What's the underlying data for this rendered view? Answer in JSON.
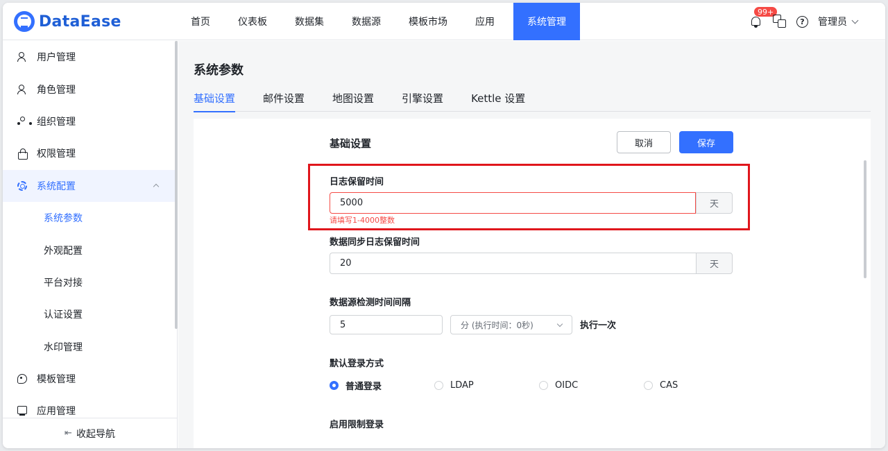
{
  "app": {
    "name": "DataEase"
  },
  "topnav": {
    "items": [
      {
        "label": "首页"
      },
      {
        "label": "仪表板"
      },
      {
        "label": "数据集"
      },
      {
        "label": "数据源"
      },
      {
        "label": "模板市场"
      },
      {
        "label": "应用"
      },
      {
        "label": "系统管理"
      }
    ],
    "active_index": 6
  },
  "header": {
    "notification_badge": "99+",
    "user": "管理员",
    "help_icon": "?"
  },
  "sidebar": {
    "items": [
      {
        "label": "用户管理",
        "icon": "user-icon"
      },
      {
        "label": "角色管理",
        "icon": "role-icon"
      },
      {
        "label": "组织管理",
        "icon": "org-icon"
      },
      {
        "label": "权限管理",
        "icon": "lock-icon"
      },
      {
        "label": "系统配置",
        "icon": "gear-icon"
      },
      {
        "label": "系统参数"
      },
      {
        "label": "外观配置"
      },
      {
        "label": "平台对接"
      },
      {
        "label": "认证设置"
      },
      {
        "label": "水印管理"
      },
      {
        "label": "模板管理",
        "icon": "palette-icon"
      },
      {
        "label": "应用管理",
        "icon": "app-icon"
      }
    ],
    "collapse_label": "收起导航"
  },
  "page": {
    "title": "系统参数",
    "tabs": [
      {
        "label": "基础设置"
      },
      {
        "label": "邮件设置"
      },
      {
        "label": "地图设置"
      },
      {
        "label": "引擎设置"
      },
      {
        "label": "Kettle 设置"
      }
    ]
  },
  "form": {
    "section_title": "基础设置",
    "cancel_label": "取消",
    "save_label": "保存",
    "log_retention": {
      "label": "日志保留时间",
      "value": "5000",
      "suffix": "天",
      "error": "请填写1-4000整数"
    },
    "sync_log_retention": {
      "label": "数据同步日志保留时间",
      "value": "20",
      "suffix": "天"
    },
    "ds_check_interval": {
      "label": "数据源检测时间间隔",
      "value": "5",
      "unit_selected": "分 (执行时间：0秒)",
      "suffix_text": "执行一次"
    },
    "default_login": {
      "label": "默认登录方式",
      "options": [
        "普通登录",
        "LDAP",
        "OIDC",
        "CAS"
      ],
      "selected_index": 0
    },
    "limit_login": {
      "label": "启用限制登录"
    }
  },
  "colors": {
    "accent": "#3370ff",
    "error": "#f54a45",
    "highlight": "#e0161c"
  }
}
